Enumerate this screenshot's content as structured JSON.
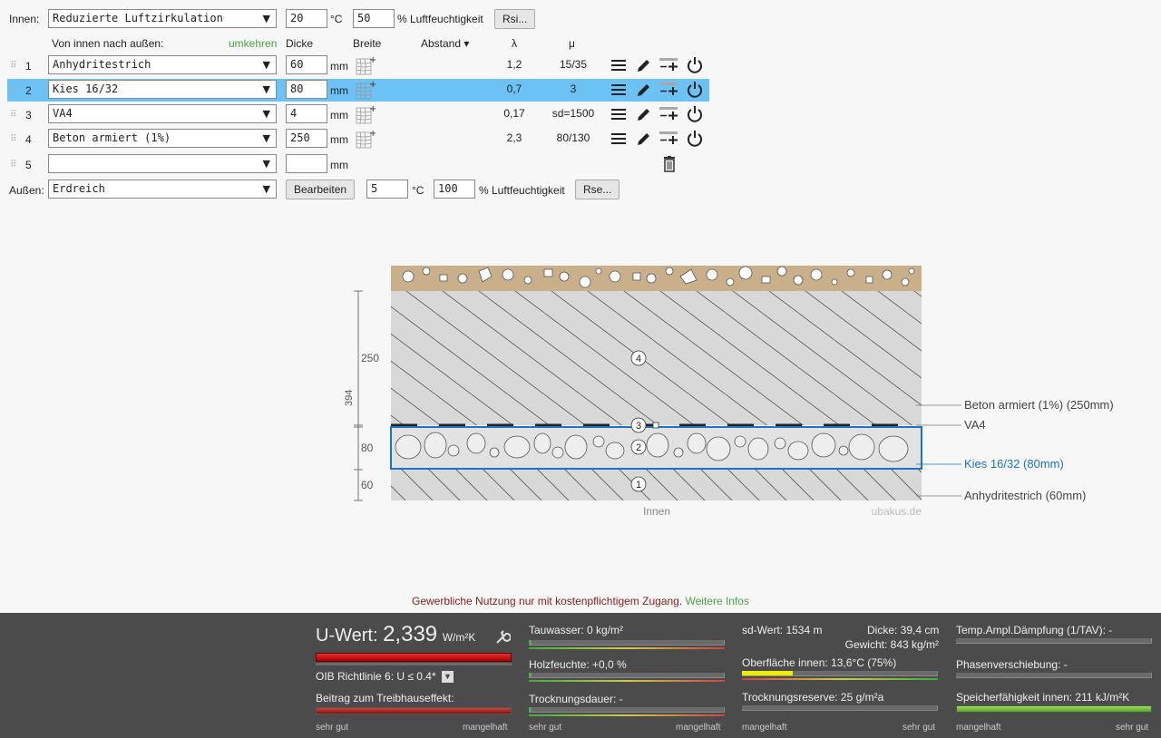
{
  "inner": {
    "label": "Innen:",
    "climate": "Reduzierte Luftzirkulation",
    "temp": "20",
    "temp_unit": "°C",
    "humidity": "50",
    "humidity_label": "% Luftfeuchtigkeit",
    "rsi_button": "Rsi..."
  },
  "header": {
    "direction": "Von innen nach außen:",
    "reverse": "umkehren",
    "thickness": "Dicke",
    "width": "Breite",
    "spacing": "Abstand ▾",
    "lambda": "λ",
    "mu": "μ"
  },
  "layers": [
    {
      "index": "1",
      "material": "Anhydritestrich",
      "thickness": "60",
      "unit": "mm",
      "lambda": "1,2",
      "mu": "15/35"
    },
    {
      "index": "2",
      "material": "Kies 16/32",
      "thickness": "80",
      "unit": "mm",
      "lambda": "0,7",
      "mu": "3"
    },
    {
      "index": "3",
      "material": "VA4",
      "thickness": "4",
      "unit": "mm",
      "lambda": "0,17",
      "mu": "sd=1500"
    },
    {
      "index": "4",
      "material": "Beton armiert (1%)",
      "thickness": "250",
      "unit": "mm",
      "lambda": "2,3",
      "mu": "80/130"
    },
    {
      "index": "5",
      "material": "",
      "thickness": "",
      "unit": "mm",
      "lambda": "",
      "mu": ""
    }
  ],
  "outer": {
    "label": "Außen:",
    "climate": "Erdreich",
    "edit_button": "Bearbeiten",
    "temp": "5",
    "temp_unit": "°C",
    "humidity": "100",
    "humidity_label": "% Luftfeuchtigkeit",
    "rse_button": "Rse..."
  },
  "diagram": {
    "dim_250": "250",
    "dim_80": "80",
    "dim_60": "60",
    "dim_total": "394",
    "marker_1": "1",
    "marker_2": "2",
    "marker_3": "3",
    "marker_4": "4",
    "label_beton": "Beton armiert (1%) (250mm)",
    "label_va4": "VA4",
    "label_kies": "Kies 16/32 (80mm)",
    "label_anhydrit": "Anhydritestrich (60mm)",
    "inside": "Innen",
    "watermark": "ubakus.de",
    "colors": {
      "ground": "#c9b08a",
      "concrete": "#d8d8d8",
      "gravel": "#e2e2e2",
      "screed": "#d8d8d8",
      "highlight": "#1a73c8"
    }
  },
  "notice": {
    "text": "Gewerbliche Nutzung nur mit kostenpflichtigem Zugang.",
    "link": "Weitere Infos"
  },
  "results": {
    "u_label": "U-Wert:",
    "u_value": "2,339",
    "u_unit": "W/m²K",
    "oib": "OIB Richtlinie 6: U ≤ 0.4*",
    "greenhouse": "Beitrag zum Treibhauseffekt:",
    "tauwasser": "Tauwasser: 0 kg/m²",
    "holzfeuchte": "Holzfeuchte: +0,0 %",
    "trocknung": "Trocknungsdauer: -",
    "sd": "sd-Wert: 1534 m",
    "dicke": "Dicke: 39,4 cm",
    "gewicht": "Gewicht: 843 kg/m²",
    "oberflaeche": "Oberfläche innen: 13,6°C (75%)",
    "reserve": "Trocknungsreserve: 25 g/m²a",
    "tav": "Temp.Ampl.Dämpfung (1/TAV): -",
    "phase": "Phasenverschiebung: -",
    "speicher": "Speicherfähigkeit innen: 211 kJ/m²K",
    "scale_good": "sehr gut",
    "scale_bad": "mangelhaft"
  }
}
